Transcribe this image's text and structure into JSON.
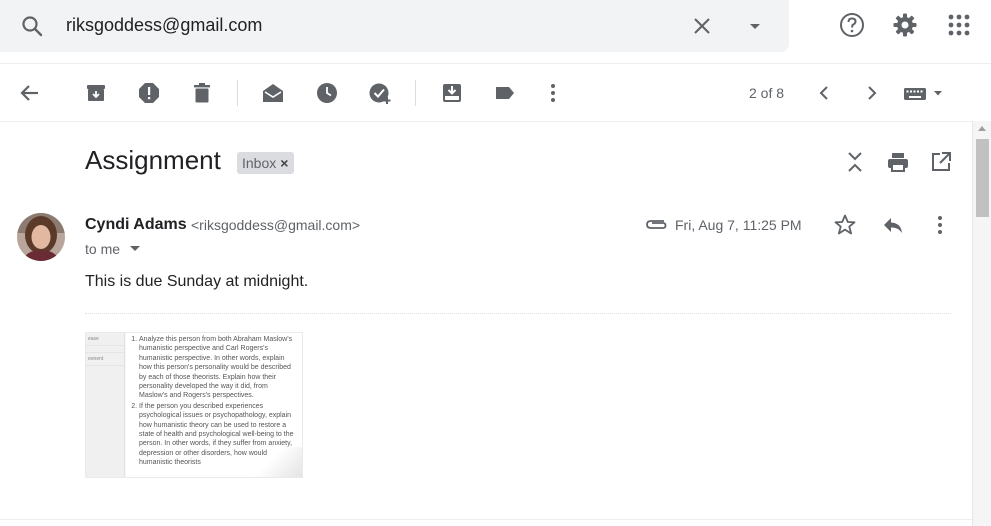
{
  "search": {
    "query": "riksgoddess@gmail.com",
    "icons": [
      "search-icon",
      "clear-icon",
      "search-options-icon"
    ]
  },
  "header_icons": [
    "help-icon",
    "settings-icon",
    "apps-icon"
  ],
  "toolbar": {
    "icons": [
      "back-icon",
      "archive-icon",
      "report-spam-icon",
      "delete-icon",
      "mark-unread-icon",
      "snooze-icon",
      "add-task-icon",
      "move-to-icon",
      "labels-icon",
      "more-icon"
    ],
    "pager": "2 of 8",
    "input_tools": "keyboard-icon"
  },
  "thread": {
    "subject": "Assignment",
    "label": "Inbox",
    "label_remove": "×",
    "actions": [
      "expand-all-icon",
      "print-icon",
      "open-new-window-icon"
    ]
  },
  "message": {
    "sender_name": "Cyndi Adams",
    "sender_email": "<riksgoddess@gmail.com>",
    "recipient": "to me",
    "date": "Fri, Aug 7, 11:25 PM",
    "has_attachment": true,
    "body": "This is due Sunday at midnight.",
    "attachment": {
      "items": [
        "Analyze this person from both Abraham Maslow's humanistic perspective and Carl Rogers's humanistic perspective. In other words, explain how this person's personality would be described by each of those theorists. Explain how their personality developed the way it did, from Maslow's and Rogers's perspectives.",
        "If the person you described experiences psychological issues or psychopathology, explain how humanistic theory can be used to restore a state of health and psychological well-being to the person. In other words, if they suffer from anxiety, depression or other disorders, how would humanistic theorists"
      ],
      "sidebar": [
        "ease",
        "",
        "eonent"
      ]
    }
  },
  "colors": {
    "icon": "#5f6368",
    "search_bg": "#f1f3f4",
    "chip_bg": "#dadce0"
  }
}
